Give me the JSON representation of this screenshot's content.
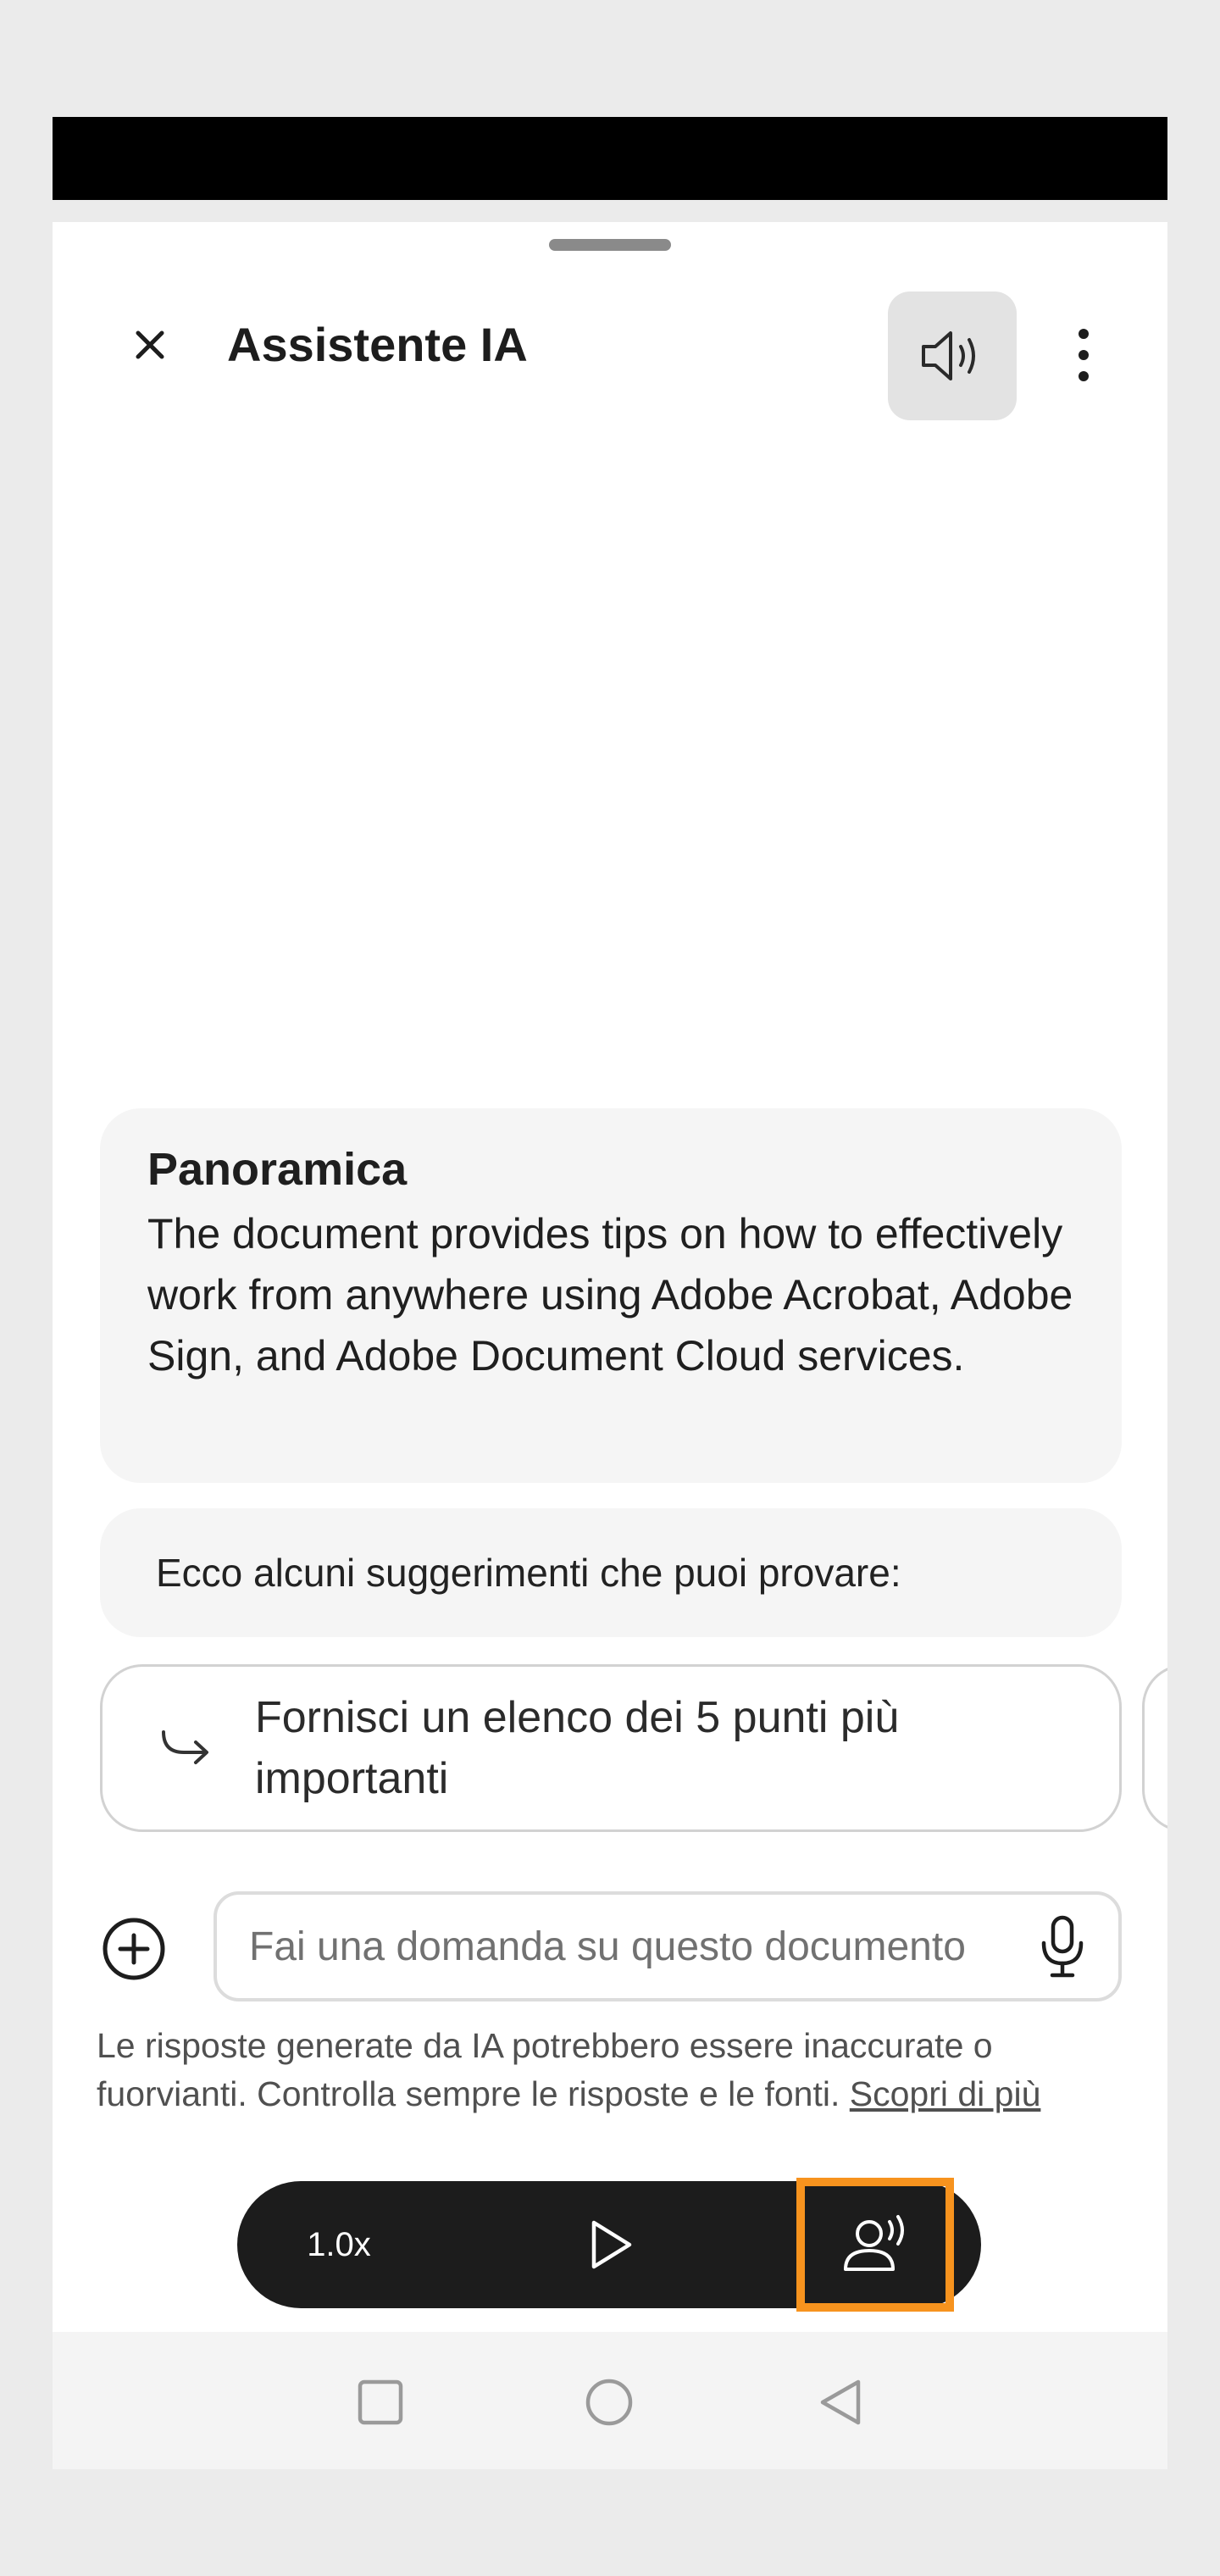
{
  "header": {
    "title": "Assistente IA",
    "icons": {
      "close": "close-icon",
      "audio": "speaker-icon",
      "more": "more-vertical-icon"
    }
  },
  "summary": {
    "title": "Panoramica",
    "body": "The document provides tips on how to effectively work from anywhere using Adobe Acrobat, Adobe Sign, and Adobe Document Cloud services."
  },
  "suggestions": {
    "hint": "Ecco alcuni suggerimenti che puoi provare:",
    "items": [
      {
        "label": "Fornisci un elenco dei 5 punti più importanti",
        "icon": "arrow-return-icon"
      }
    ]
  },
  "composer": {
    "placeholder": "Fai una domanda su questo documento",
    "value": ""
  },
  "disclaimer": {
    "text": "Le risposte generate da IA potrebbero essere inaccurate o fuorvianti. Controlla sempre le risposte e le fonti.",
    "link": "Scopri di più"
  },
  "player": {
    "speed": "1.0x"
  },
  "colors": {
    "highlight": "#f7931e",
    "player_bg": "#1c1c1c",
    "card_bg": "#f5f5f5"
  }
}
